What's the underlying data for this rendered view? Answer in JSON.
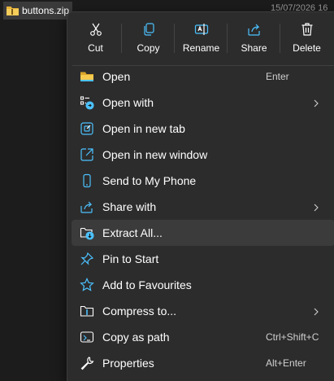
{
  "file": {
    "name": "buttons.zip",
    "icon": "zip-folder-icon"
  },
  "datetime": "15/07/2026 16",
  "quick_actions": [
    {
      "label": "Cut",
      "icon": "scissors-icon"
    },
    {
      "label": "Copy",
      "icon": "copy-icon"
    },
    {
      "label": "Rename",
      "icon": "rename-icon"
    },
    {
      "label": "Share",
      "icon": "share-icon"
    },
    {
      "label": "Delete",
      "icon": "trash-icon"
    }
  ],
  "menu_items": [
    {
      "label": "Open",
      "shortcut": "Enter",
      "icon": "folder-icon"
    },
    {
      "label": "Open with",
      "submenu": true,
      "icon": "open-with-icon"
    },
    {
      "label": "Open in new tab",
      "icon": "new-tab-icon"
    },
    {
      "label": "Open in new window",
      "icon": "new-window-icon"
    },
    {
      "label": "Send to My Phone",
      "icon": "phone-icon"
    },
    {
      "label": "Share with",
      "submenu": true,
      "icon": "share-with-icon"
    },
    {
      "label": "Extract All...",
      "icon": "extract-icon",
      "highlighted": true
    },
    {
      "label": "Pin to Start",
      "icon": "pin-icon"
    },
    {
      "label": "Add to Favourites",
      "icon": "star-icon"
    },
    {
      "label": "Compress to...",
      "submenu": true,
      "icon": "compress-icon"
    },
    {
      "label": "Copy as path",
      "shortcut": "Ctrl+Shift+C",
      "icon": "copy-path-icon"
    },
    {
      "label": "Properties",
      "shortcut": "Alt+Enter",
      "icon": "wrench-icon"
    }
  ],
  "colors": {
    "accent": "#4cc2ff",
    "menu_bg": "#2c2c2c",
    "folder": "#f3c04a"
  }
}
